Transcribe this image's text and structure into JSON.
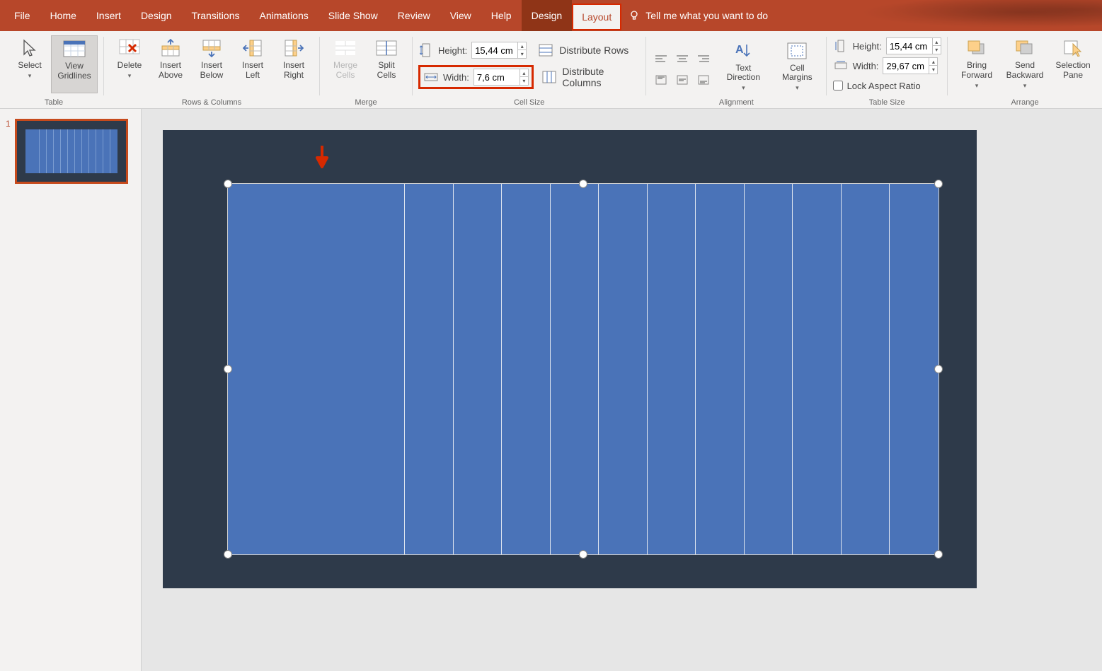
{
  "menu": {
    "tabs": [
      "File",
      "Home",
      "Insert",
      "Design",
      "Transitions",
      "Animations",
      "Slide Show",
      "Review",
      "View",
      "Help"
    ],
    "context_tab": "Design",
    "active_tab": "Layout",
    "tellme": "Tell me what you want to do"
  },
  "ribbon": {
    "table": {
      "select": "Select",
      "view_gridlines": "View\nGridlines",
      "delete": "Delete",
      "group_label": "Table"
    },
    "rows_columns": {
      "insert_above": "Insert\nAbove",
      "insert_below": "Insert\nBelow",
      "insert_left": "Insert\nLeft",
      "insert_right": "Insert\nRight",
      "group_label": "Rows & Columns"
    },
    "merge": {
      "merge_cells": "Merge\nCells",
      "split_cells": "Split\nCells",
      "group_label": "Merge"
    },
    "cell_size": {
      "height_label": "Height:",
      "height_value": "15,44 cm",
      "width_label": "Width:",
      "width_value": "7,6 cm",
      "distribute_rows": "Distribute Rows",
      "distribute_columns": "Distribute Columns",
      "group_label": "Cell Size"
    },
    "alignment": {
      "text_direction": "Text\nDirection",
      "cell_margins": "Cell\nMargins",
      "group_label": "Alignment"
    },
    "table_size": {
      "height_label": "Height:",
      "height_value": "15,44 cm",
      "width_label": "Width:",
      "width_value": "29,67 cm",
      "lock_aspect": "Lock Aspect Ratio",
      "group_label": "Table Size"
    },
    "arrange": {
      "bring_forward": "Bring\nForward",
      "send_backward": "Send\nBackward",
      "selection_pane": "Selection\nPane",
      "group_label": "Arrange"
    }
  },
  "thumbnail": {
    "number": "1"
  },
  "colors": {
    "brand": "#b7472a",
    "highlight": "#d62900",
    "slide_bg": "#2e3a4a",
    "table_cell": "#4a73b8"
  }
}
